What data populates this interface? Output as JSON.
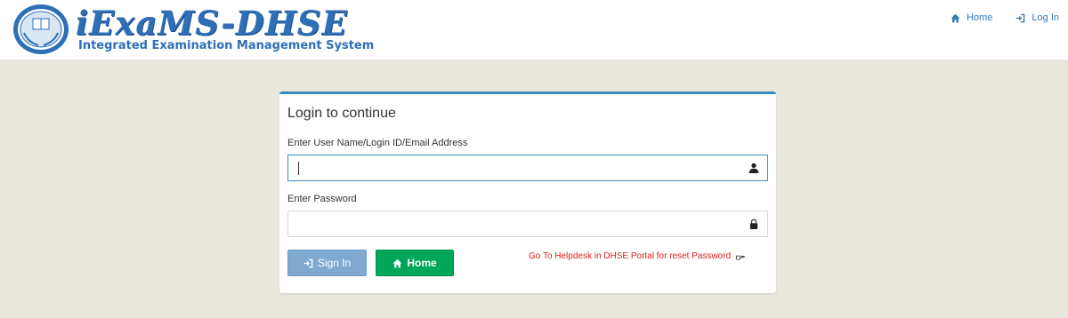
{
  "header": {
    "brand_title": "iExaMS-DHSE",
    "brand_subtitle": "Integrated Examination Management System",
    "logo_text": "iExaMS",
    "nav": {
      "home": "Home",
      "login": "Log In"
    }
  },
  "login_panel": {
    "title": "Login to continue",
    "username_label": "Enter User Name/Login ID/Email Address",
    "username_value": "",
    "password_label": "Enter Password",
    "password_value": "",
    "sign_in_label": "Sign In",
    "home_label": "Home",
    "helpdesk_link": "Go To Helpdesk in DHSE Portal for reset Password"
  },
  "colors": {
    "brand": "#2f6fb8",
    "page_background": "#e9e6de",
    "panel_accent": "#3c8dbc",
    "sign_in_button": "#7fa9cf",
    "home_button": "#00a65a",
    "helpdesk_link": "#dd1e1e"
  },
  "icons": {
    "nav_home": "home-icon",
    "nav_login": "sign-in-icon",
    "username": "user-icon",
    "password": "lock-icon",
    "sign_in": "sign-in-icon",
    "home": "home-icon",
    "helpdesk": "hand-pointer-icon"
  }
}
